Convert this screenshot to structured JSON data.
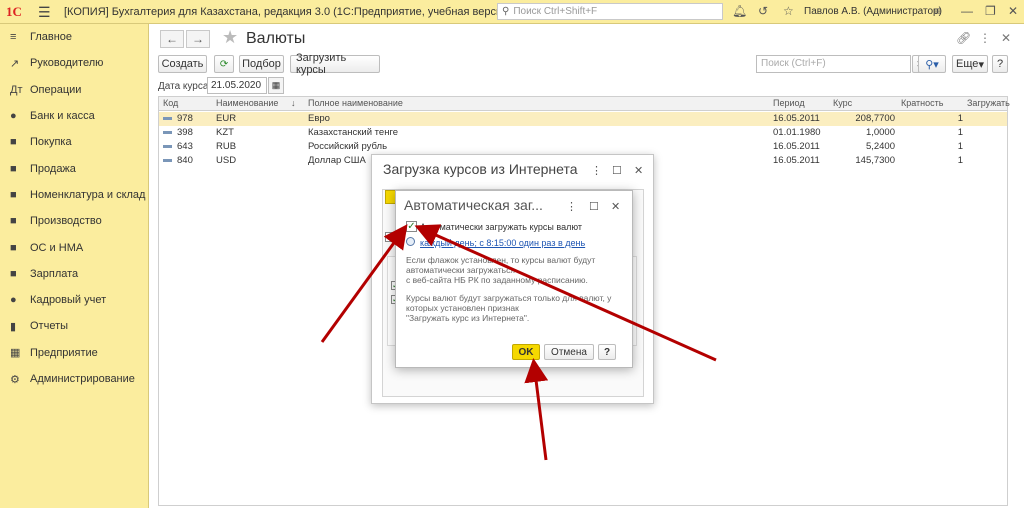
{
  "window": {
    "logo": "1С",
    "title": "[КОПИЯ] Бухгалтерия для Казахстана, редакция 3.0  (1С:Предприятие, учебная версия)",
    "search_placeholder": "Поиск Ctrl+Shift+F",
    "user": "Павлов А.В. (Администратор)"
  },
  "sidebar": {
    "items": [
      {
        "label": "Главное",
        "icon": "≡"
      },
      {
        "label": "Руководителю",
        "icon": "↗"
      },
      {
        "label": "Операции",
        "icon": "Дт"
      },
      {
        "label": "Банк и касса",
        "icon": "●"
      },
      {
        "label": "Покупка",
        "icon": "■"
      },
      {
        "label": "Продажа",
        "icon": "■"
      },
      {
        "label": "Номенклатура и склад",
        "icon": "■"
      },
      {
        "label": "Производство",
        "icon": "■"
      },
      {
        "label": "ОС и НМА",
        "icon": "■"
      },
      {
        "label": "Зарплата",
        "icon": "■"
      },
      {
        "label": "Кадровый учет",
        "icon": "●"
      },
      {
        "label": "Отчеты",
        "icon": "▮"
      },
      {
        "label": "Предприятие",
        "icon": "▦"
      },
      {
        "label": "Администрирование",
        "icon": "⚙"
      }
    ]
  },
  "page": {
    "title": "Валюты",
    "toolbar": {
      "create": "Создать",
      "select": "Подбор",
      "load_rates": "Загрузить курсы",
      "search_placeholder": "Поиск (Ctrl+F)",
      "more": "Еще"
    },
    "date_label": "Дата курса:",
    "date_value": "21.05.2020"
  },
  "table": {
    "columns": [
      "Код",
      "Наименование",
      "Полное наименование",
      "Период",
      "Курс",
      "Кратность",
      "Загружать"
    ],
    "rows": [
      {
        "code": "978",
        "name": "EUR",
        "full": "Евро",
        "period": "16.05.2011",
        "rate": "208,7700",
        "mult": "1"
      },
      {
        "code": "398",
        "name": "KZT",
        "full": "Казахстанский тенге",
        "period": "01.01.1980",
        "rate": "1,0000",
        "mult": "1"
      },
      {
        "code": "643",
        "name": "RUB",
        "full": "Российский рубль",
        "period": "16.05.2011",
        "rate": "5,2400",
        "mult": "1"
      },
      {
        "code": "840",
        "name": "USD",
        "full": "Доллар США",
        "period": "16.05.2011",
        "rate": "145,7300",
        "mult": "1"
      }
    ]
  },
  "dialog_load": {
    "title": "Загрузка курсов из Интернета"
  },
  "dialog_auto": {
    "title": "Автоматическая заг...",
    "checkbox_label": "Автоматически загружать курсы валют",
    "schedule_link": "каждый день; с 8:15:00 один раз в день",
    "note1": [
      "Если флажок установлен, то курсы валют будут",
      "автоматически загружаться",
      "с веб-сайта НБ РК по заданному расписанию."
    ],
    "note2": [
      "Курсы валют будут загружаться только для валют, у",
      "которых установлен признак",
      "\"Загружать курс из Интернета\"."
    ],
    "ok": "OK",
    "cancel": "Отмена",
    "help": "?"
  },
  "colors": {
    "sidebar": "#fbed9e",
    "selected_row": "#fbeec0",
    "ok_button": "#f5d800",
    "arrow": "#b30000"
  }
}
